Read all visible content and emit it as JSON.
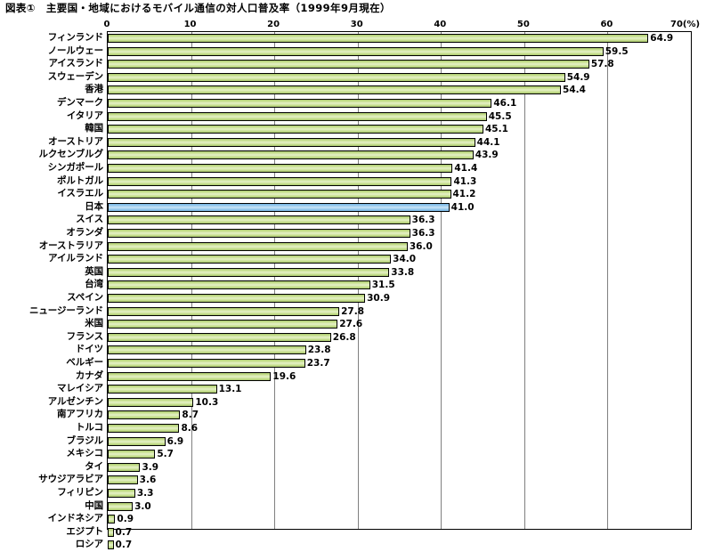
{
  "title": "図表①　主要国・地域におけるモバイル通信の対人口普及率（1999年9月現在）",
  "axis": {
    "unit_suffix": "(%)",
    "ticks": [
      "0",
      "10",
      "20",
      "30",
      "40",
      "50",
      "60",
      "70"
    ]
  },
  "colors": {
    "bar_green": "#cfe49b",
    "bar_blue": "#9fcdee",
    "bar_border": "#000000",
    "gridline": "#808080",
    "frame": "#000000",
    "text": "#000000"
  },
  "chart_data": {
    "type": "bar",
    "orientation": "horizontal",
    "title": "図表①　主要国・地域におけるモバイル通信の対人口普及率（1999年9月現在）",
    "xlabel": "(%)",
    "ylabel": "",
    "xlim": [
      0,
      70
    ],
    "xticks": [
      0,
      10,
      20,
      30,
      40,
      50,
      60,
      70
    ],
    "grid": true,
    "legend": false,
    "highlight_category": "日本",
    "categories": [
      "フィンランド",
      "ノールウェー",
      "アイスランド",
      "スウェーデン",
      "香港",
      "デンマーク",
      "イタリア",
      "韓国",
      "オーストリア",
      "ルクセンブルグ",
      "シンガポール",
      "ポルトガル",
      "イスラエル",
      "日本",
      "スイス",
      "オランダ",
      "オーストラリア",
      "アイルランド",
      "英国",
      "台湾",
      "スペイン",
      "ニュージーランド",
      "米国",
      "フランス",
      "ドイツ",
      "ベルギー",
      "カナダ",
      "マレイシア",
      "アルゼンチン",
      "南アフリカ",
      "トルコ",
      "ブラジル",
      "メキシコ",
      "タイ",
      "サウジアラビア",
      "フィリピン",
      "中国",
      "インドネシア",
      "エジプト",
      "ロシア"
    ],
    "values": [
      64.9,
      59.5,
      57.8,
      54.9,
      54.4,
      46.1,
      45.5,
      45.1,
      44.1,
      43.9,
      41.4,
      41.3,
      41.2,
      41.0,
      36.3,
      36.3,
      36.0,
      34.0,
      33.8,
      31.5,
      30.9,
      27.8,
      27.6,
      26.8,
      23.8,
      23.7,
      19.6,
      13.1,
      10.3,
      8.7,
      8.6,
      6.9,
      5.7,
      3.9,
      3.6,
      3.3,
      3.0,
      0.9,
      0.7,
      0.7
    ],
    "value_labels": [
      "64.9",
      "59.5",
      "57.8",
      "54.9",
      "54.4",
      "46.1",
      "45.5",
      "45.1",
      "44.1",
      "43.9",
      "41.4",
      "41.3",
      "41.2",
      "41.0",
      "36.3",
      "36.3",
      "36.0",
      "34.0",
      "33.8",
      "31.5",
      "30.9",
      "27.8",
      "27.6",
      "26.8",
      "23.8",
      "23.7",
      "19.6",
      "13.1",
      "10.3",
      "8.7",
      "8.6",
      "6.9",
      "5.7",
      "3.9",
      "3.6",
      "3.3",
      "3.0",
      "0.9",
      "0.7",
      "0.7"
    ]
  }
}
